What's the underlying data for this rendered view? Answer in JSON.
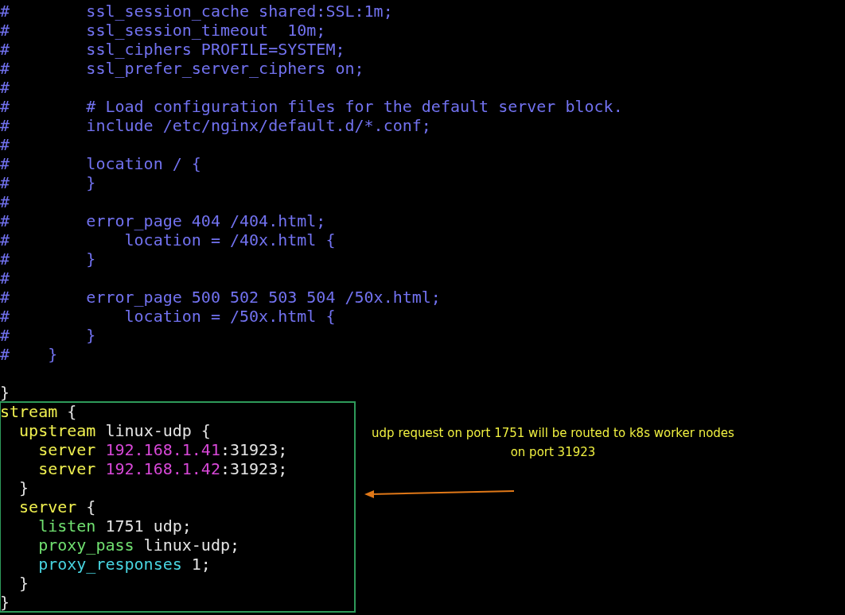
{
  "code_lines": [
    {
      "segments": [
        {
          "kind": "comment",
          "text": "#        ssl_session_cache shared:SSL:1m;"
        }
      ]
    },
    {
      "segments": [
        {
          "kind": "comment",
          "text": "#        ssl_session_timeout  10m;"
        }
      ]
    },
    {
      "segments": [
        {
          "kind": "comment",
          "text": "#        ssl_ciphers PROFILE=SYSTEM;"
        }
      ]
    },
    {
      "segments": [
        {
          "kind": "comment",
          "text": "#        ssl_prefer_server_ciphers on;"
        }
      ]
    },
    {
      "segments": [
        {
          "kind": "comment",
          "text": "#"
        }
      ]
    },
    {
      "segments": [
        {
          "kind": "comment",
          "text": "#        # Load configuration files for the default server block."
        }
      ]
    },
    {
      "segments": [
        {
          "kind": "comment",
          "text": "#        include /etc/nginx/default.d/*.conf;"
        }
      ]
    },
    {
      "segments": [
        {
          "kind": "comment",
          "text": "#"
        }
      ]
    },
    {
      "segments": [
        {
          "kind": "comment",
          "text": "#        location / {"
        }
      ]
    },
    {
      "segments": [
        {
          "kind": "comment",
          "text": "#        }"
        }
      ]
    },
    {
      "segments": [
        {
          "kind": "comment",
          "text": "#"
        }
      ]
    },
    {
      "segments": [
        {
          "kind": "comment",
          "text": "#        error_page 404 /404.html;"
        }
      ]
    },
    {
      "segments": [
        {
          "kind": "comment",
          "text": "#            location = /40x.html {"
        }
      ]
    },
    {
      "segments": [
        {
          "kind": "comment",
          "text": "#        }"
        }
      ]
    },
    {
      "segments": [
        {
          "kind": "comment",
          "text": "#"
        }
      ]
    },
    {
      "segments": [
        {
          "kind": "comment",
          "text": "#        error_page 500 502 503 504 /50x.html;"
        }
      ]
    },
    {
      "segments": [
        {
          "kind": "comment",
          "text": "#            location = /50x.html {"
        }
      ]
    },
    {
      "segments": [
        {
          "kind": "comment",
          "text": "#        }"
        }
      ]
    },
    {
      "segments": [
        {
          "kind": "comment",
          "text": "#    }"
        }
      ]
    }
  ],
  "closing_line": {
    "segments": [
      {
        "kind": "plain",
        "text": "}"
      }
    ]
  },
  "highlighted_block": [
    {
      "segments": [
        {
          "kind": "keyword",
          "text": "stream"
        },
        {
          "kind": "plain",
          "text": " {"
        }
      ]
    },
    {
      "segments": [
        {
          "kind": "keyword",
          "text": "  upstream"
        },
        {
          "kind": "plain",
          "text": " linux-udp {"
        }
      ]
    },
    {
      "segments": [
        {
          "kind": "keyword",
          "text": "    server "
        },
        {
          "kind": "address",
          "text": "192.168.1.41"
        },
        {
          "kind": "plain",
          "text": ":31923;"
        }
      ]
    },
    {
      "segments": [
        {
          "kind": "keyword",
          "text": "    server "
        },
        {
          "kind": "address",
          "text": "192.168.1.42"
        },
        {
          "kind": "plain",
          "text": ":31923;"
        }
      ]
    },
    {
      "segments": [
        {
          "kind": "plain",
          "text": "  }"
        }
      ]
    },
    {
      "segments": [
        {
          "kind": "keyword",
          "text": "  server"
        },
        {
          "kind": "plain",
          "text": " {"
        }
      ]
    },
    {
      "segments": [
        {
          "kind": "directive",
          "text": "    listen"
        },
        {
          "kind": "plain",
          "text": " 1751 udp;"
        }
      ]
    },
    {
      "segments": [
        {
          "kind": "directive",
          "text": "    proxy_pass"
        },
        {
          "kind": "plain",
          "text": " linux-udp;"
        }
      ]
    },
    {
      "segments": [
        {
          "kind": "setting",
          "text": "    proxy_responses"
        },
        {
          "kind": "plain",
          "text": " 1;"
        }
      ]
    },
    {
      "segments": [
        {
          "kind": "plain",
          "text": "  }"
        }
      ]
    },
    {
      "segments": [
        {
          "kind": "plain",
          "text": "}"
        }
      ]
    }
  ],
  "annotation": {
    "lines": [
      "udp request on port 1751 will be routed to k8s worker nodes",
      "on port 31923"
    ]
  }
}
